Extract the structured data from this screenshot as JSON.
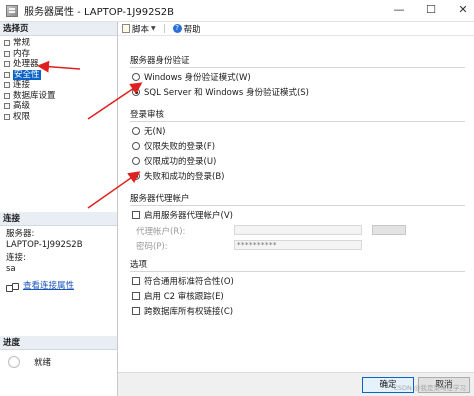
{
  "window": {
    "title": "服务器属性 - LAPTOP-1J992S2B",
    "minimize_glyph": "—",
    "maximize_glyph": "☐",
    "close_glyph": "✕"
  },
  "left_panel": {
    "select_page_header": "选择页",
    "nav_items": [
      {
        "label": "常规",
        "selected": false
      },
      {
        "label": "内存",
        "selected": false
      },
      {
        "label": "处理器",
        "selected": false
      },
      {
        "label": "安全性",
        "selected": true
      },
      {
        "label": "连接",
        "selected": false
      },
      {
        "label": "数据库设置",
        "selected": false
      },
      {
        "label": "高级",
        "selected": false
      },
      {
        "label": "权限",
        "selected": false
      }
    ],
    "connect_header": "连接",
    "server_label": "服务器:",
    "server_value": "LAPTOP-1J992S2B",
    "connection_label": "连接:",
    "connection_value": "sa",
    "view_properties_link": "查看连接属性",
    "progress_header": "进度",
    "progress_status": "就绪"
  },
  "toolbar": {
    "script_label": "脚本",
    "help_label": "帮助"
  },
  "server_auth": {
    "title": "服务器身份验证",
    "options": [
      {
        "label": "Windows 身份验证模式(W)",
        "checked": false
      },
      {
        "label": "SQL Server 和 Windows 身份验证模式(S)",
        "checked": true
      }
    ]
  },
  "login_audit": {
    "title": "登录审核",
    "options": [
      {
        "label": "无(N)",
        "checked": false
      },
      {
        "label": "仅限失败的登录(F)",
        "checked": false
      },
      {
        "label": "仅限成功的登录(U)",
        "checked": false
      },
      {
        "label": "失败和成功的登录(B)",
        "checked": true
      }
    ]
  },
  "proxy_account": {
    "title": "服务器代理帐户",
    "enable_label": "启用服务器代理帐户(V)",
    "proxy_account_label": "代理帐户(R):",
    "password_label": "密码(P):",
    "password_value": "**********"
  },
  "options": {
    "title": "选项",
    "items": [
      {
        "label": "符合通用标准符合性(O)",
        "checked": false
      },
      {
        "label": "启用 C2 审核跟踪(E)",
        "checked": false
      },
      {
        "label": "跨数据库所有权链接(C)",
        "checked": false
      }
    ]
  },
  "buttons": {
    "ok_label": "确定",
    "cancel_label": "取消"
  },
  "watermark": "CSDN @我是菜鸟在学习",
  "colors": {
    "selection": "#0a64c8",
    "annotation_arrow": "#e02020",
    "link": "#1a52b8"
  }
}
